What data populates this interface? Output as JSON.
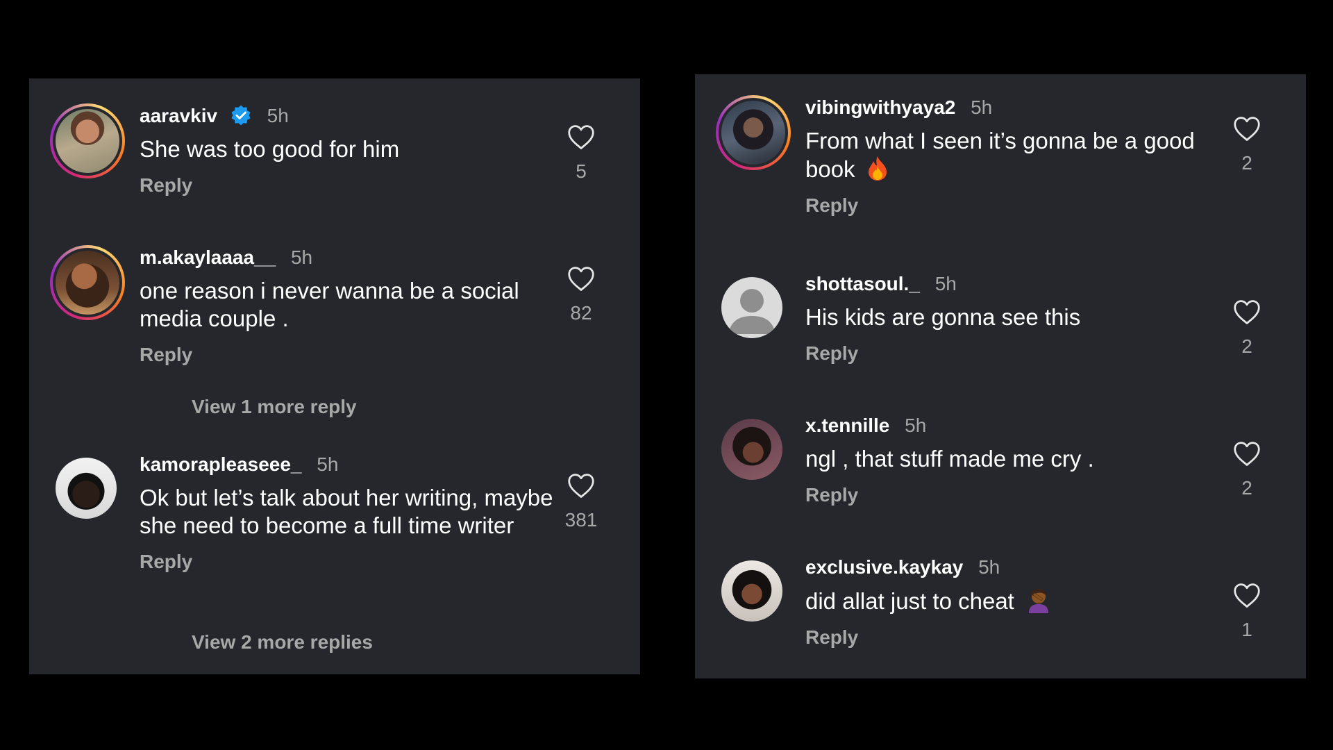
{
  "left_panel": {
    "comments": [
      {
        "username": "aaravkiv",
        "verified": true,
        "time": "5h",
        "text": "She was too good for him",
        "reply": "Reply",
        "likes": "5"
      },
      {
        "username": "m.akaylaaaa__",
        "verified": false,
        "time": "5h",
        "text": "one reason i never wanna be a social media couple .",
        "reply": "Reply",
        "likes": "82"
      },
      {
        "username": "kamorapleaseee_",
        "verified": false,
        "time": "5h",
        "text": "Ok but let’s talk about her writing, maybe she need to become a full time writer",
        "reply": "Reply",
        "likes": "381"
      }
    ],
    "view_more_1": "View 1 more reply",
    "view_more_2": "View 2 more replies"
  },
  "right_panel": {
    "comments": [
      {
        "username": "vibingwithyaya2",
        "time": "5h",
        "text": "From what I seen it’s gonna be a good book",
        "emoji": "fire-emoji",
        "reply": "Reply",
        "likes": "2"
      },
      {
        "username": "shottasoul._",
        "time": "5h",
        "text": "His kids are gonna see this",
        "reply": "Reply",
        "likes": "2"
      },
      {
        "username": "x.tennille",
        "time": "5h",
        "text": "ngl , that stuff made me cry .",
        "reply": "Reply",
        "likes": "2"
      },
      {
        "username": "exclusive.kaykay",
        "time": "5h",
        "text": "did allat just to cheat",
        "emoji": "facepalm-emoji",
        "reply": "Reply",
        "likes": "1"
      }
    ]
  },
  "colors": {
    "background": "#000000",
    "panel": "#25272c",
    "text_primary": "#ffffff",
    "text_secondary": "#a8a8a8",
    "verified_blue": "#1d9bf0"
  },
  "icons": [
    "heart-outline-icon",
    "verified-badge-icon",
    "default-avatar-icon",
    "fire-emoji",
    "facepalm-emoji"
  ]
}
